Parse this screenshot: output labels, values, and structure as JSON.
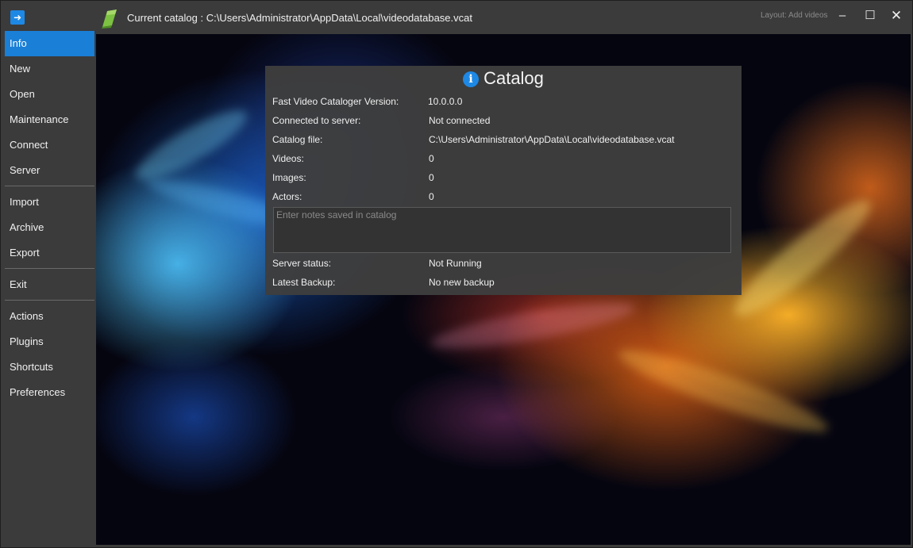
{
  "titlebar": {
    "back_icon": "arrow-right-icon",
    "logo_icon": "app-logo-icon",
    "title": "Current catalog : C:\\Users\\Administrator\\AppData\\Local\\videodatabase.vcat",
    "layout_label": "Layout: Add videos",
    "minimize": "‒",
    "maximize": "☐",
    "close": "✕"
  },
  "sidebar": {
    "accent": "#1a7fd6",
    "group1": [
      "Info",
      "New",
      "Open",
      "Maintenance",
      "Connect",
      "Server"
    ],
    "group2": [
      "Import",
      "Archive",
      "Export"
    ],
    "group3": [
      "Exit"
    ],
    "group4": [
      "Actions",
      "Plugins",
      "Shortcuts",
      "Preferences"
    ],
    "active": "Info"
  },
  "panel": {
    "title": "Catalog",
    "info_icon": "i",
    "version_label": "Fast Video Cataloger Version:",
    "version_value": "10.0.0.0",
    "server_conn_label": "Connected to server:",
    "server_conn_value": "Not connected",
    "catalog_file_label": "Catalog file:",
    "catalog_file_value": "C:\\Users\\Administrator\\AppData\\Local\\videodatabase.vcat",
    "videos_label": "Videos:",
    "videos_value": "0",
    "images_label": "Images:",
    "images_value": "0",
    "actors_label": "Actors:",
    "actors_value": "0",
    "notes_placeholder": "Enter notes saved in catalog",
    "server_status_label": "Server status:",
    "server_status_value": "Not Running",
    "backup_label": "Latest Backup:",
    "backup_value": "No new backup"
  }
}
